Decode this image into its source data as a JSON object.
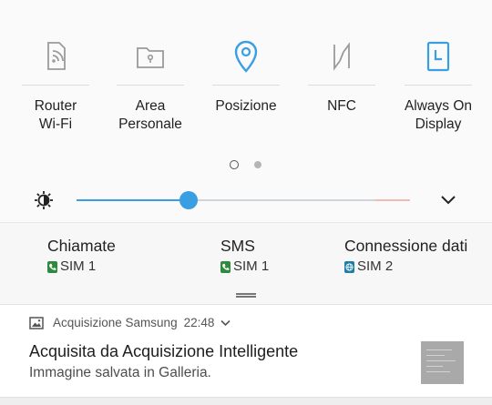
{
  "quick_settings": {
    "tiles": [
      {
        "label": "Router\nWi-Fi",
        "icon": "hotspot-icon",
        "active": false
      },
      {
        "label": "Area\nPersonale",
        "icon": "secure-folder-icon",
        "active": false
      },
      {
        "label": "Posizione",
        "icon": "location-pin-icon",
        "active": true
      },
      {
        "label": "NFC",
        "icon": "nfc-icon",
        "active": false
      },
      {
        "label": "Always On\nDisplay",
        "icon": "always-on-display-icon",
        "active": true
      }
    ],
    "page_count": 2,
    "current_page": 1,
    "brightness_level": 0.33,
    "accent_color": "#3a9ee3",
    "inactive_icon_color": "#9a9a9a"
  },
  "sim_settings": [
    {
      "title": "Chiamate",
      "sim": "SIM 1",
      "badge_color": "#2e8b3e",
      "icon": "phone-icon"
    },
    {
      "title": "SMS",
      "sim": "SIM 1",
      "badge_color": "#2e8b3e",
      "icon": "phone-icon"
    },
    {
      "title": "Connessione dati",
      "sim": "SIM 2",
      "badge_color": "#1d7fa6",
      "icon": "globe-icon"
    }
  ],
  "notification": {
    "app": "Acquisizione Samsung",
    "time": "22:48",
    "title": "Acquisita da Acquisizione Intelligente",
    "text": "Immagine salvata in Galleria."
  }
}
